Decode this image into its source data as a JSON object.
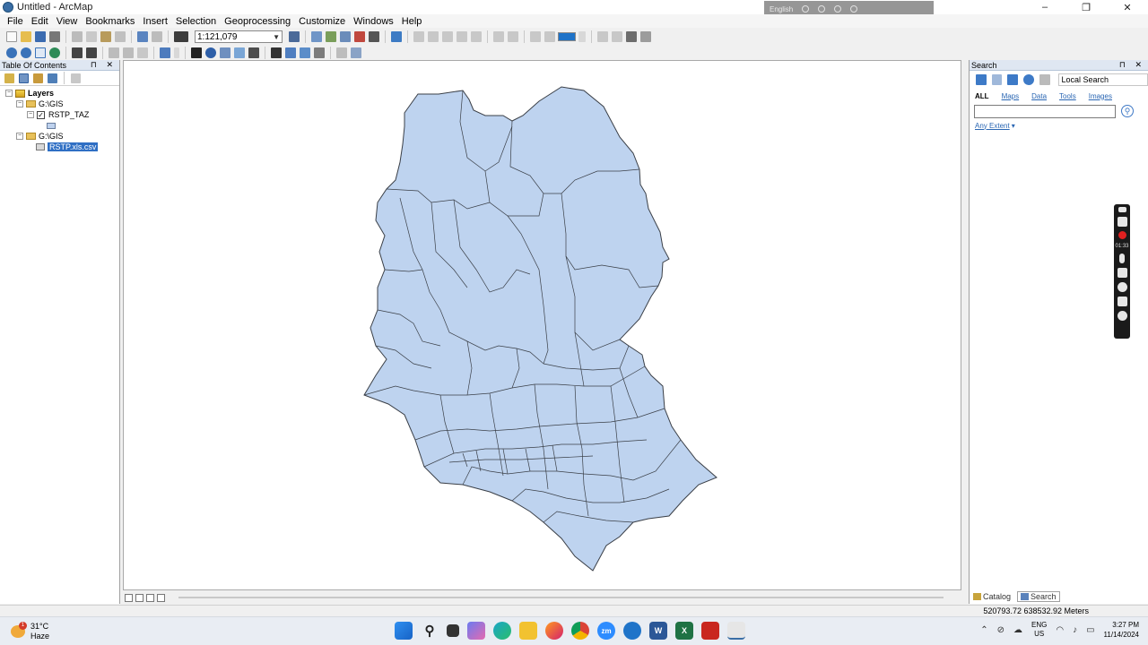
{
  "window": {
    "title": "Untitled - ArcMap",
    "controls": [
      "–",
      "❐",
      "✕"
    ]
  },
  "language_bar": {
    "label": "English"
  },
  "menu": [
    "File",
    "Edit",
    "View",
    "Bookmarks",
    "Insert",
    "Selection",
    "Geoprocessing",
    "Customize",
    "Windows",
    "Help"
  ],
  "toolbar": {
    "scale_value": "1:121,079",
    "fill_color": "#1e72c8"
  },
  "toc": {
    "title": "Table Of Contents",
    "header_controls": "⊓ ✕",
    "tree": {
      "root": "Layers",
      "group1": "G:\\GIS",
      "layer1": "RSTP_TAZ",
      "group2": "G:\\GIS",
      "table1": "RSTP.xls.csv"
    }
  },
  "map": {
    "fill_color": "#bed3ef",
    "stroke_color": "#3a3f47",
    "background": "#ffffff"
  },
  "search": {
    "title": "Search",
    "header_controls": "⊓ ✕",
    "scope": "Local Search",
    "tabs": [
      "ALL",
      "Maps",
      "Data",
      "Tools",
      "Images"
    ],
    "extent_label": "Any Extent",
    "input_value": ""
  },
  "panel_tabs": [
    "Catalog",
    "Search"
  ],
  "status": {
    "coordinates": "520793.72  638532.92 Meters"
  },
  "recorder": {
    "time": "01:33"
  },
  "taskbar": {
    "weather_temp": "31°C",
    "weather_desc": "Haze",
    "weather_badge": "1",
    "lang_line1": "ENG",
    "lang_line2": "US",
    "time": "3:27 PM",
    "date": "11/14/2024",
    "apps": [
      "start",
      "search",
      "task-view",
      "copilot",
      "edge",
      "file-explorer",
      "firefox",
      "chrome",
      "zoom",
      "remote",
      "word",
      "excel",
      "acrobat",
      "arcmap"
    ]
  }
}
